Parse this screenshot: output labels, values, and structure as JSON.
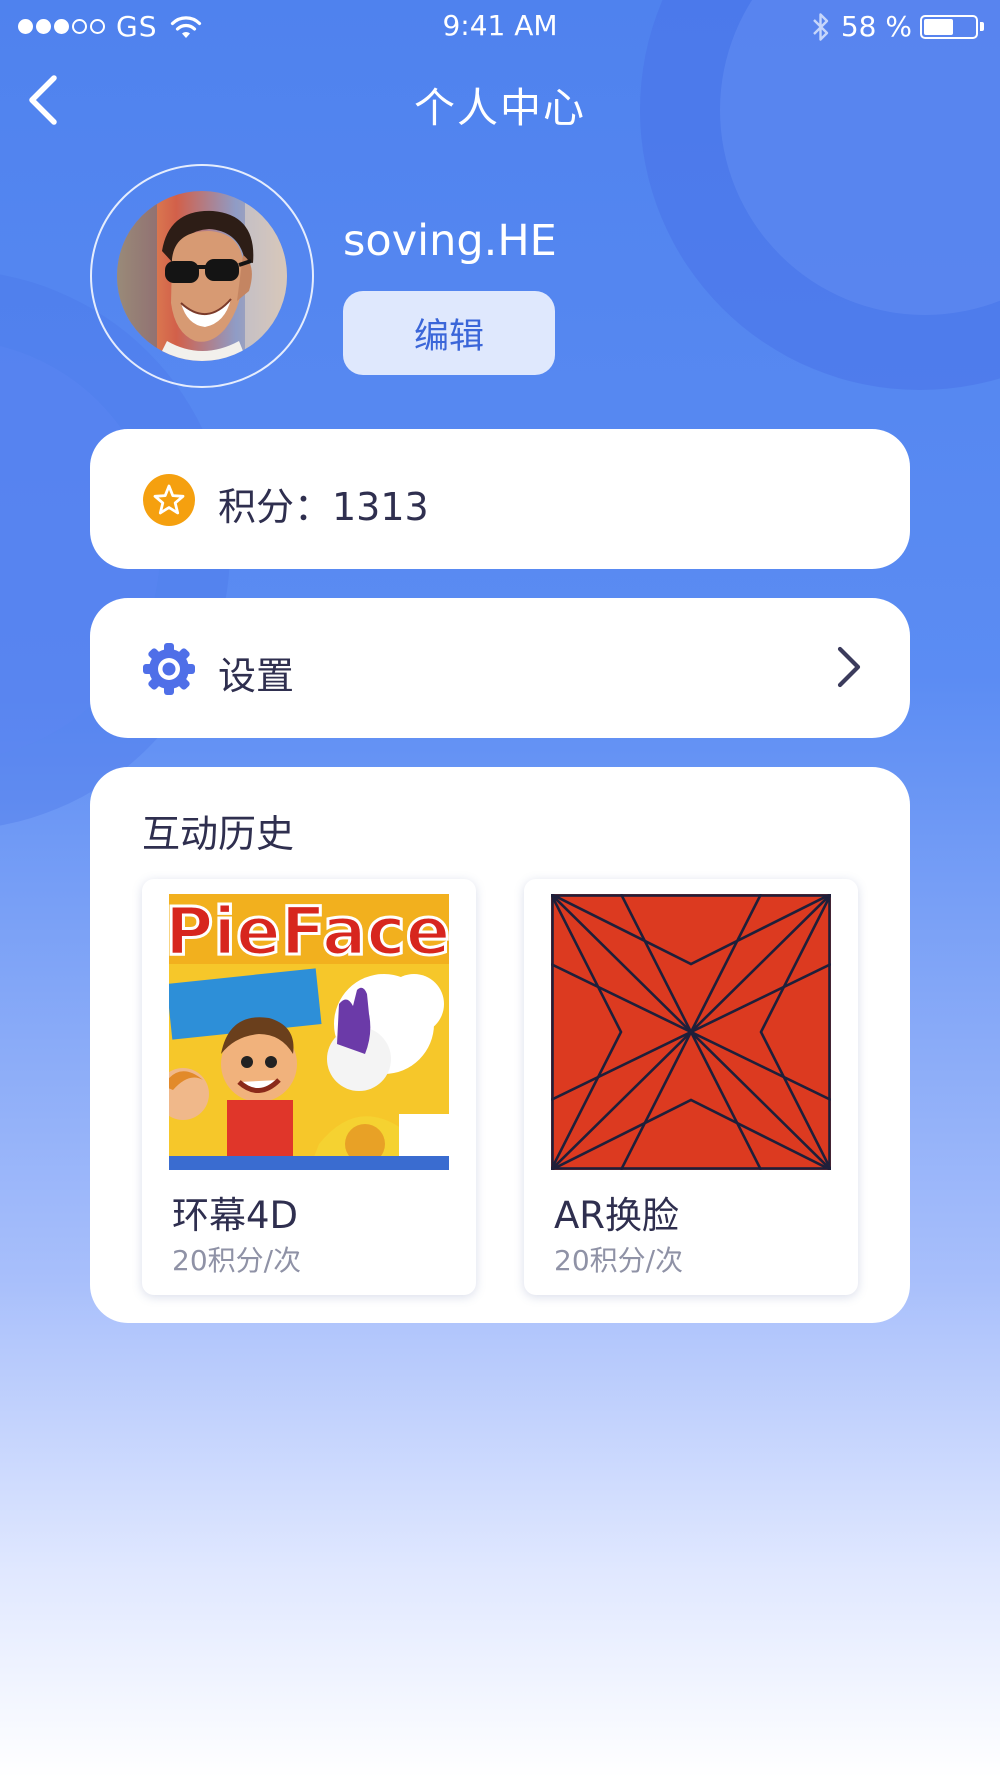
{
  "status_bar": {
    "carrier": "GS",
    "time": "9:41 AM",
    "battery": "58 %",
    "battery_level": 0.58,
    "signal_bars_filled": 3,
    "signal_bars_total": 5
  },
  "nav": {
    "title": "个人中心",
    "back_icon": "chevron-left-icon"
  },
  "profile": {
    "username": "soving.HE",
    "edit_label": "编辑"
  },
  "points": {
    "label": "积分：1313",
    "icon": "star-icon",
    "icon_color": "#f5a00f"
  },
  "settings": {
    "label": "设置",
    "icon": "gear-icon",
    "icon_color": "#4f6fe8"
  },
  "history": {
    "title": "互动历史",
    "items": [
      {
        "name": "环幕4D",
        "price": "20积分/次",
        "thumb_text": "PieFace!"
      },
      {
        "name": "AR换脸",
        "price": "20积分/次"
      }
    ]
  },
  "colors": {
    "background_top": "#4f82ee",
    "background_bottom": "#ffffff",
    "edit_button_bg": "#dfe8fd",
    "edit_button_text": "#3b66d9"
  }
}
